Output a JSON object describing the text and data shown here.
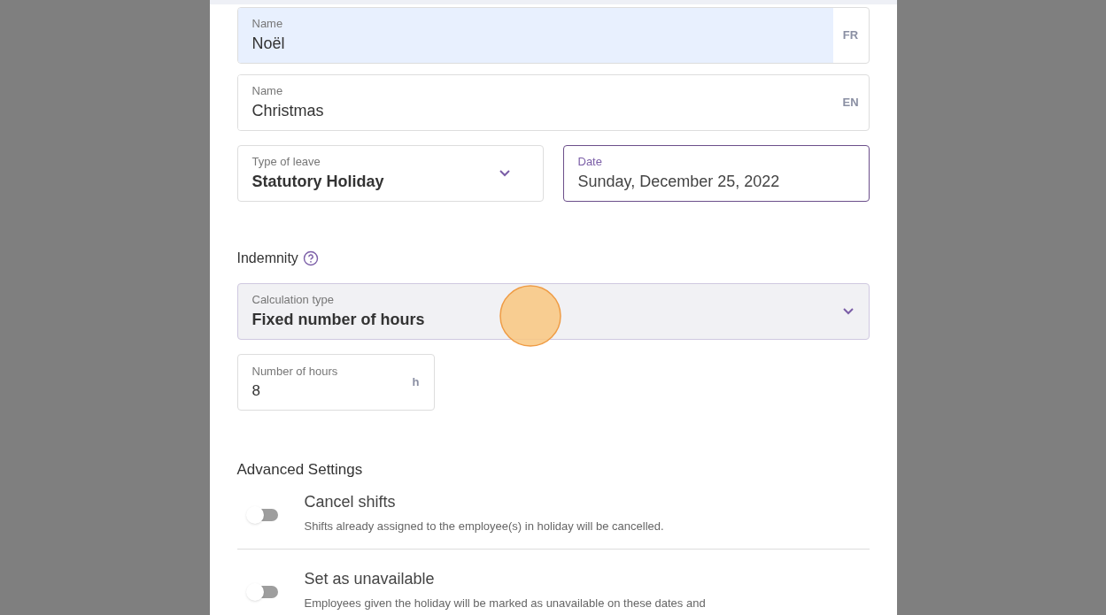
{
  "name_fields": [
    {
      "label": "Name",
      "value": "Noël",
      "suffix": "FR",
      "autofilled": true
    },
    {
      "label": "Name",
      "value": "Christmas",
      "suffix": "EN",
      "autofilled": false
    }
  ],
  "leave_row": [
    {
      "kind": "select",
      "label": "Type of leave",
      "value": "Statutory Holiday",
      "focused": false
    },
    {
      "kind": "text",
      "label": "Date",
      "value": "Sunday, December 25, 2022",
      "focused": true
    }
  ],
  "indemnity": {
    "heading": "Indemnity",
    "calculation": {
      "label": "Calculation type",
      "value": "Fixed number of hours"
    },
    "hours": {
      "label": "Number of hours",
      "value": "8",
      "suffix": "h"
    }
  },
  "advanced": {
    "heading": "Advanced Settings",
    "toggles": [
      {
        "title": "Cancel shifts",
        "description": "Shifts already assigned to the employee(s) in holiday will be cancelled.",
        "on": false
      },
      {
        "title": "Set as unavailable",
        "description": "Employees given the holiday will be marked as unavailable on these dates and",
        "on": false
      }
    ]
  }
}
